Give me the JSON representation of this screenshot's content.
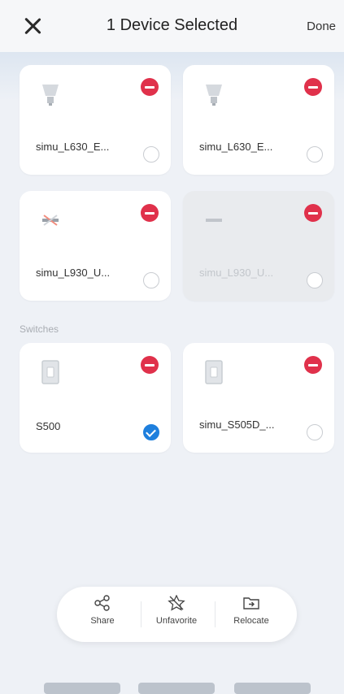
{
  "header": {
    "title": "1 Device Selected",
    "done_label": "Done",
    "close_icon": "close-icon"
  },
  "devices": [
    {
      "name": "simu_L630_E...",
      "icon": "bulb-icon",
      "selected": false
    },
    {
      "name": "simu_L630_E...",
      "icon": "bulb-icon",
      "selected": false
    },
    {
      "name": "simu_L930_U...",
      "icon": "light-strip-icon",
      "selected": false
    },
    {
      "name": "simu_L930_U...",
      "icon": "light-strip-icon",
      "selected": false
    }
  ],
  "section_switches": "Switches",
  "switches": [
    {
      "name": "S500",
      "icon": "switch-icon",
      "selected": true
    },
    {
      "name": "simu_S505D_...",
      "icon": "switch-icon",
      "selected": false
    }
  ],
  "toolbar": {
    "share_label": "Share",
    "unfavorite_label": "Unfavorite",
    "relocate_label": "Relocate"
  },
  "colors": {
    "remove_badge": "#e0314b",
    "selected_check": "#1e7fdd"
  }
}
